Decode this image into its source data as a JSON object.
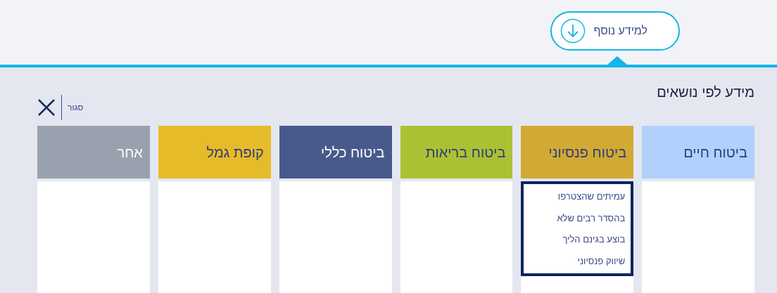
{
  "more_info_button": {
    "label": "למידע נוסף"
  },
  "panel": {
    "title": "מידע לפי נושאים",
    "close_label": "סגור"
  },
  "columns": [
    {
      "title": "ביטוח חיים",
      "color": "#b0d1fb",
      "selected": false
    },
    {
      "title": "ביטוח פנסיוני",
      "color": "#d0aa33",
      "selected": true,
      "items": [
        "עמיתים שהצטרפו",
        "בהסדר רבים שלא",
        "בוצע בגינם הליך",
        "שיווק פנסיוני"
      ]
    },
    {
      "title": "ביטוח בריאות",
      "color": "#abc133",
      "selected": false
    },
    {
      "title": "ביטוח כללי",
      "color": "#485a8c",
      "selected": false
    },
    {
      "title": "קופת גמל",
      "color": "#e6bb2a",
      "selected": false
    },
    {
      "title": "אחר",
      "color": "#98a1ad",
      "selected": false
    }
  ]
}
